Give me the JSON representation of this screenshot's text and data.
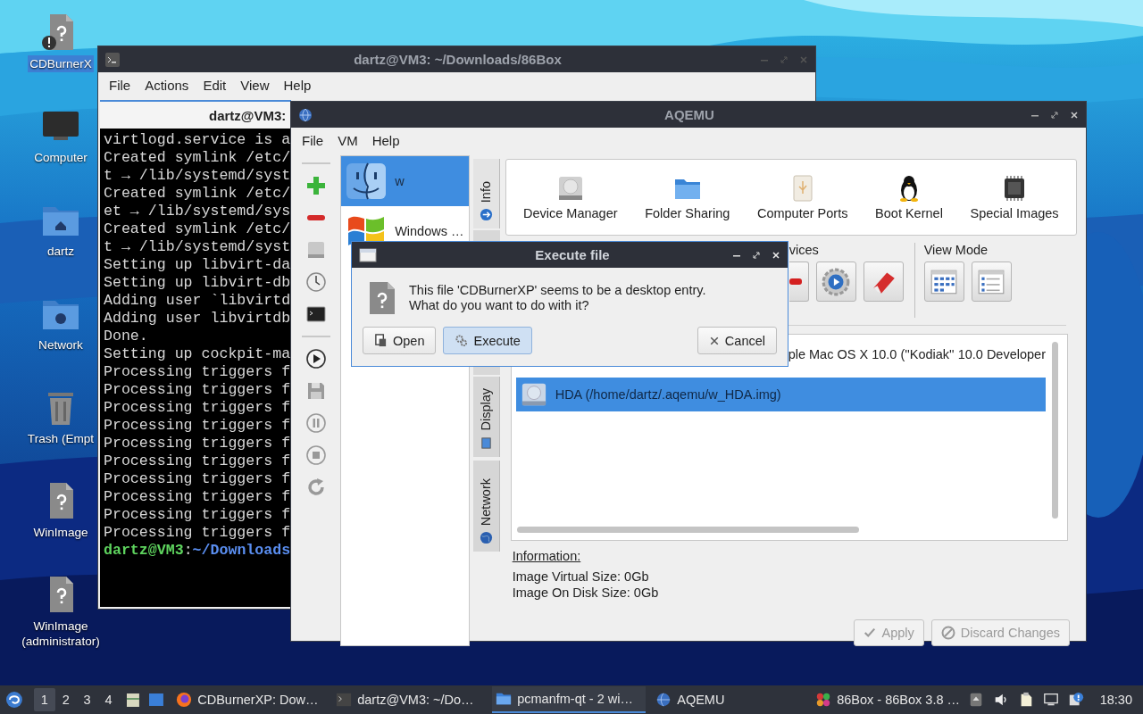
{
  "desktop_icons": [
    {
      "label": "CDBurnerX",
      "selected": true,
      "kind": "file-warning"
    },
    {
      "label": "Computer",
      "selected": false,
      "kind": "computer"
    },
    {
      "label": "dartz",
      "selected": false,
      "kind": "home-folder"
    },
    {
      "label": "Network",
      "selected": false,
      "kind": "network-folder"
    },
    {
      "label": "Trash (Empt",
      "selected": false,
      "kind": "trash"
    },
    {
      "label": "WinImage",
      "selected": false,
      "kind": "file"
    },
    {
      "label": "WinImage (administrator)",
      "selected": false,
      "kind": "file"
    }
  ],
  "terminal": {
    "title": "dartz@VM3: ~/Downloads/86Box",
    "menu": [
      "File",
      "Actions",
      "Edit",
      "View",
      "Help"
    ],
    "tab_title": "dartz@VM3:",
    "lines": [
      "virtlogd.service is a",
      "Created symlink /etc/",
      "t → /lib/systemd/syst",
      "Created symlink /etc/",
      "et → /lib/systemd/sys",
      "Created symlink /etc/",
      "t → /lib/systemd/syst",
      "Setting up libvirt-da",
      "Setting up libvirt-db",
      "Adding user `libvirtd",
      "Adding user libvirtdb",
      "Done.",
      "Setting up cockpit-ma",
      "Processing triggers f",
      "Processing triggers f",
      "Processing triggers f",
      "Processing triggers f",
      "Processing triggers f",
      "Processing triggers f",
      "Processing triggers f",
      "Processing triggers f",
      "Processing triggers f",
      "Processing triggers f"
    ],
    "prompt": {
      "user": "dartz@VM3",
      "separator": ":",
      "path": "~/Downloads"
    }
  },
  "aqemu": {
    "title": "AQEMU",
    "menu": [
      "File",
      "VM",
      "Help"
    ],
    "vms": [
      {
        "name": "w",
        "selected": true,
        "kind": "mac"
      },
      {
        "name": "Windows …",
        "selected": false,
        "kind": "windows"
      }
    ],
    "side_tabs": [
      {
        "label": "Info",
        "kind": "info",
        "selected": true
      },
      {
        "label": "Display",
        "kind": "display",
        "selected": false
      },
      {
        "label": "Network",
        "kind": "network",
        "selected": false
      }
    ],
    "sections": [
      {
        "label": "Device Manager",
        "kind": "disk"
      },
      {
        "label": "Folder Sharing",
        "kind": "folder"
      },
      {
        "label": "Computer Ports",
        "kind": "usb"
      },
      {
        "label": "Boot Kernel",
        "kind": "penguin"
      },
      {
        "label": "Special Images",
        "kind": "chip"
      }
    ],
    "devices_label": "vices",
    "view_mode_label": "View Mode",
    "device_rows": [
      {
        "text": "ple Mac OS X 10.0 (''Kodiak'' 10.0 Developer",
        "selected": false,
        "kind": "clipped"
      },
      {
        "text": "HDA (/home/dartz/.aqemu/w_HDA.img)",
        "selected": true,
        "kind": "disk"
      }
    ],
    "info_title": "Information:",
    "info_lines": [
      "Image Virtual Size: 0Gb",
      "Image On Disk Size: 0Gb"
    ],
    "buttons": [
      {
        "label": "Apply",
        "disabled": true,
        "kind": "apply"
      },
      {
        "label": "Discard Changes",
        "disabled": true,
        "kind": "discard"
      }
    ]
  },
  "dialog": {
    "title": "Execute file",
    "message": "This file 'CDBurnerXP' seems to be a desktop entry.\nWhat do you want to do with it?",
    "buttons": [
      {
        "label": "Open",
        "focused": false,
        "kind": "open"
      },
      {
        "label": "Execute",
        "focused": true,
        "kind": "execute"
      },
      {
        "label": "Cancel",
        "focused": false,
        "kind": "cancel"
      }
    ]
  },
  "taskbar": {
    "desktops": [
      {
        "label": "1",
        "selected": true
      },
      {
        "label": "2",
        "selected": false
      },
      {
        "label": "3",
        "selected": false
      },
      {
        "label": "4",
        "selected": false
      }
    ],
    "tasks": [
      {
        "label": "CDBurnerXP: Dow…",
        "selected": false,
        "kind": "browser"
      },
      {
        "label": "dartz@VM3: ~/Do…",
        "selected": false,
        "kind": "terminal"
      },
      {
        "label": "pcmanfm-qt - 2 wi…",
        "selected": true,
        "kind": "folder"
      },
      {
        "label": "AQEMU",
        "selected": false,
        "kind": "aqemu"
      },
      {
        "label": "86Box - 86Box 3.8 …",
        "selected": false,
        "kind": "box"
      }
    ],
    "clock": "18:30"
  }
}
